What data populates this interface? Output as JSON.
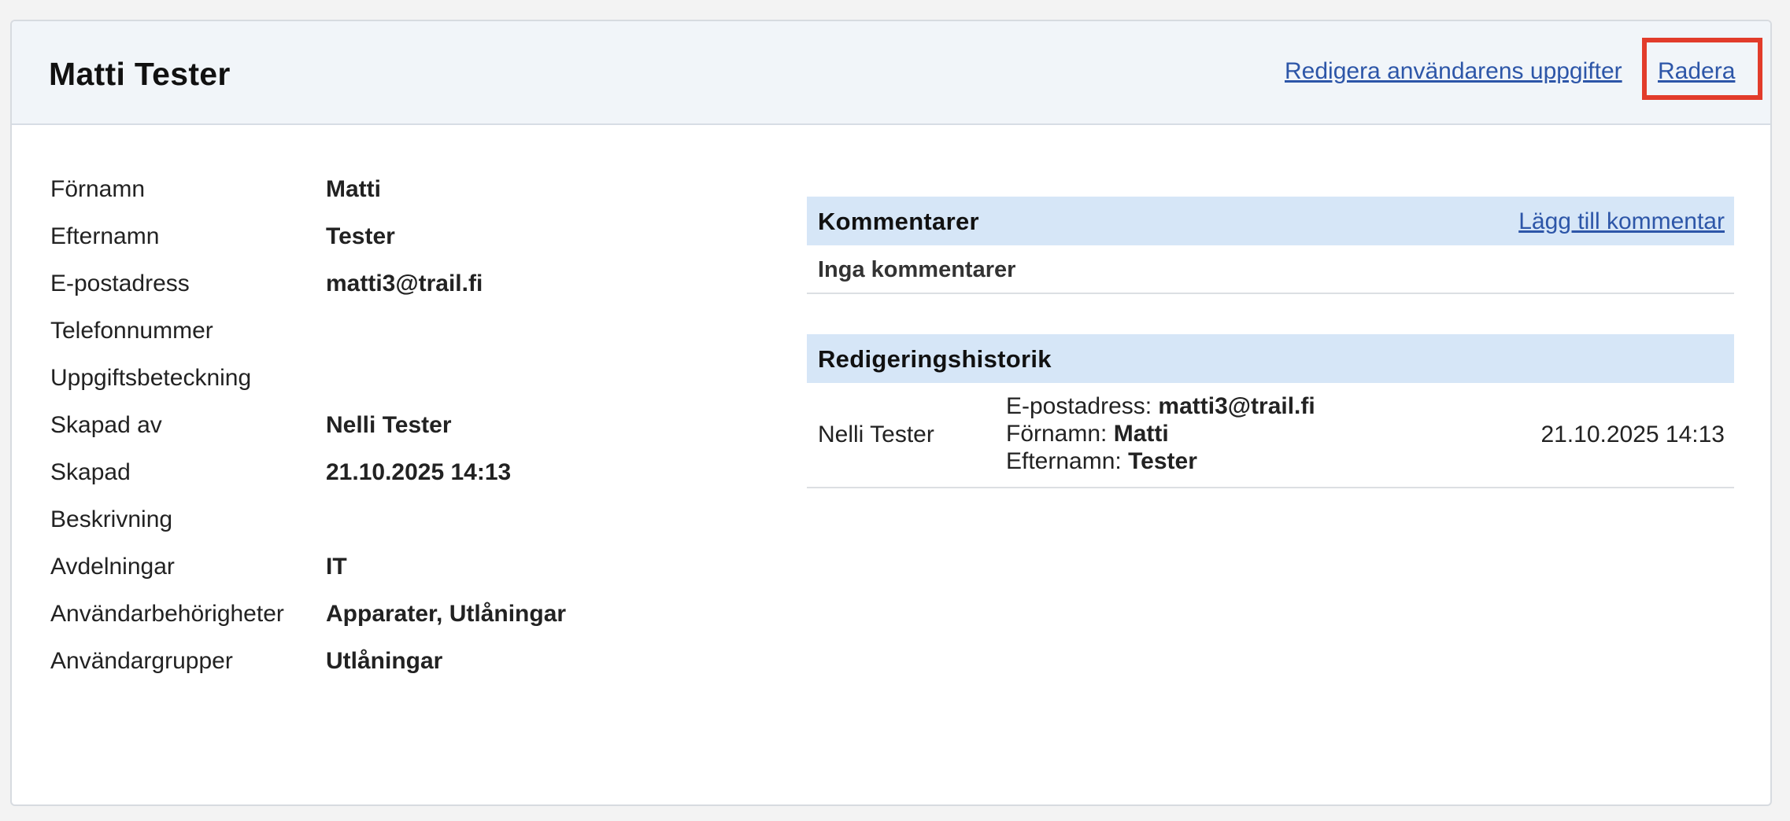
{
  "header": {
    "title": "Matti Tester",
    "edit_link": "Redigera användarens uppgifter",
    "delete_link": "Radera"
  },
  "details": [
    {
      "label": "Förnamn",
      "value": "Matti"
    },
    {
      "label": "Efternamn",
      "value": "Tester"
    },
    {
      "label": "E-postadress",
      "value": "matti3@trail.fi"
    },
    {
      "label": "Telefonnummer",
      "value": ""
    },
    {
      "label": "Uppgiftsbeteckning",
      "value": ""
    },
    {
      "label": "Skapad av",
      "value": "Nelli Tester"
    },
    {
      "label": "Skapad",
      "value": "21.10.2025 14:13"
    },
    {
      "label": "Beskrivning",
      "value": ""
    },
    {
      "label": "Avdelningar",
      "value": "IT"
    },
    {
      "label": "Användarbehörigheter",
      "value": "Apparater, Utlåningar"
    },
    {
      "label": "Användargrupper",
      "value": "Utlåningar"
    }
  ],
  "comments": {
    "title": "Kommentarer",
    "add_link": "Lägg till kommentar",
    "empty_text": "Inga kommentarer"
  },
  "history": {
    "title": "Redigeringshistorik",
    "entries": [
      {
        "user": "Nelli Tester",
        "changes": [
          {
            "field": "E-postadress:",
            "value": "matti3@trail.fi"
          },
          {
            "field": "Förnamn:",
            "value": "Matti"
          },
          {
            "field": "Efternamn:",
            "value": "Tester"
          }
        ],
        "date": "21.10.2025 14:13"
      }
    ]
  },
  "colors": {
    "link": "#2d56a8",
    "highlight": "#e23c2b",
    "panel_header": "#d6e6f7",
    "card_header": "#f1f5f9"
  }
}
